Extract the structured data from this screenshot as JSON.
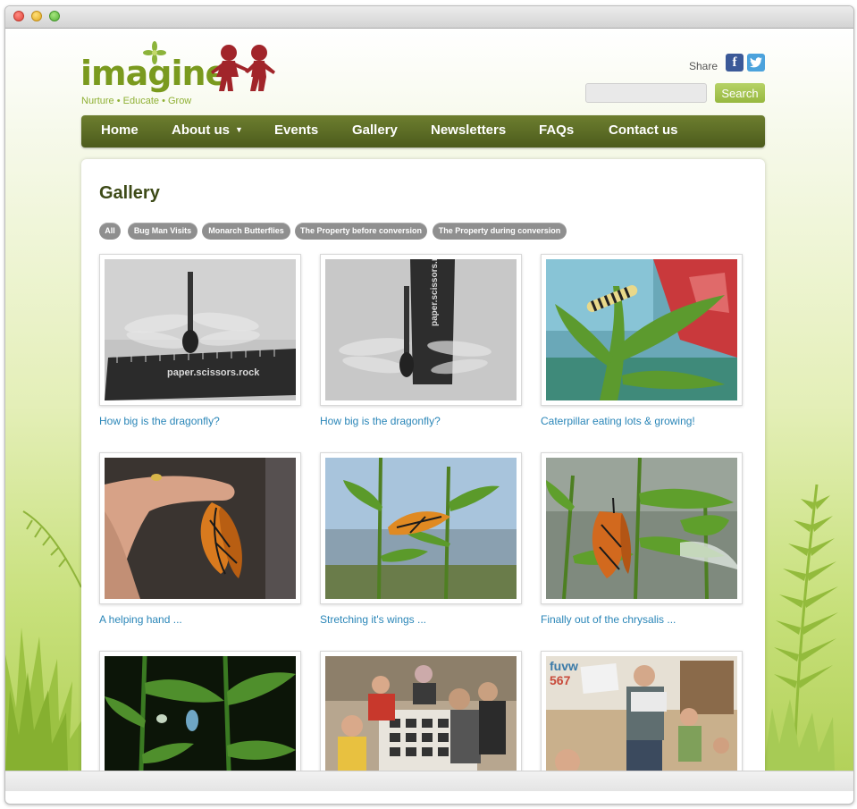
{
  "site": {
    "logo_text": "imagine",
    "tagline": "Nurture • Educate • Grow"
  },
  "header": {
    "share_label": "Share",
    "social": [
      {
        "name": "facebook-icon",
        "glyph": "f"
      },
      {
        "name": "twitter-icon",
        "glyph": "t"
      }
    ],
    "search": {
      "placeholder": "",
      "value": "",
      "button_label": "Search"
    }
  },
  "nav": {
    "items": [
      {
        "label": "Home"
      },
      {
        "label": "About us",
        "has_dropdown": true
      },
      {
        "label": "Events"
      },
      {
        "label": "Gallery"
      },
      {
        "label": "Newsletters"
      },
      {
        "label": "FAQs"
      },
      {
        "label": "Contact us"
      }
    ]
  },
  "gallery": {
    "title": "Gallery",
    "filters": [
      {
        "label": "All"
      },
      {
        "label": "Bug Man Visits"
      },
      {
        "label": "Monarch Butterflies"
      },
      {
        "label": "The Property before conversion"
      },
      {
        "label": "The Property during conversion"
      }
    ],
    "items": [
      {
        "caption": "How big is the dragonfly?",
        "photo": "dragonfly-on-ruler"
      },
      {
        "caption": "How big is the dragonfly?",
        "photo": "dragonfly-with-upright-ruler"
      },
      {
        "caption": "Caterpillar eating lots & growing!",
        "photo": "caterpillar-on-milkweed"
      },
      {
        "caption": "A helping hand ...",
        "photo": "butterfly-on-finger"
      },
      {
        "caption": "Stretching it's wings ...",
        "photo": "butterfly-on-plant-sky"
      },
      {
        "caption": "Finally out of the chrysalis ...",
        "photo": "butterfly-hanging-milkweed"
      },
      {
        "caption": "",
        "photo": "chrysalis-night"
      },
      {
        "caption": "",
        "photo": "kids-looking-at-bugs"
      },
      {
        "caption": "",
        "photo": "bug-man-presentation"
      }
    ]
  },
  "colors": {
    "nav_green": "#5a6a24",
    "title_green": "#3d4a17",
    "link_blue": "#2a86b8",
    "search_green": "#a6c450",
    "logo_red": "#a1252a"
  }
}
